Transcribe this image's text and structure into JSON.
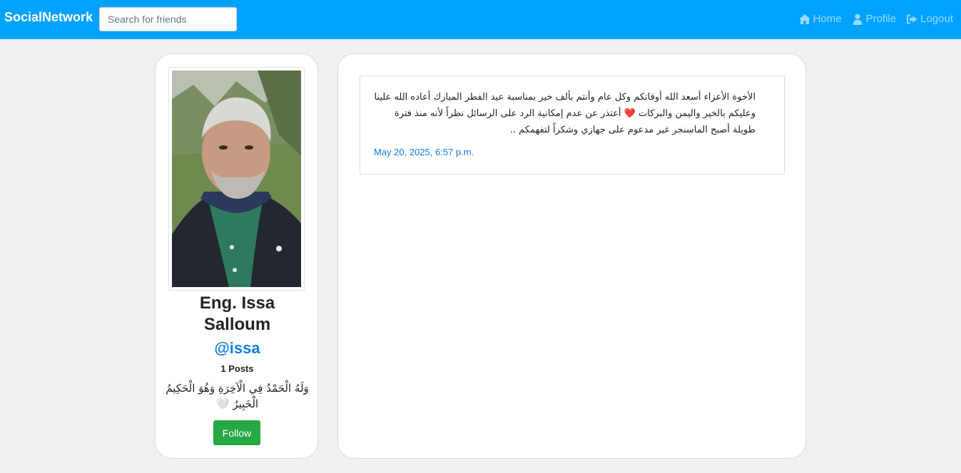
{
  "nav": {
    "brand": "SocialNetwork",
    "search_placeholder": "Search for friends",
    "links": {
      "home": "Home",
      "profile": "Profile",
      "logout": "Logout"
    }
  },
  "profile": {
    "name": "Eng. Issa Salloum",
    "handle": "@issa",
    "posts_count": "1 Posts",
    "bio": "وَلَهُ الْحَمْدُ فِي الْآخِرَةِ وَهُوَ الْحَكِيمُ الْخَبِيرُ 🤍",
    "follow_label": "Follow"
  },
  "feed": {
    "posts": [
      {
        "text": "الأخوة الأعزاء أسعد الله أوقاتكم وكل عام وأنتم بألف خير بمناسبة عيد الفطر المبارك أعاده الله علينا وعليكم بالخير واليمن والبركات ❤️ أعتذر عن عدم إمكانية الرد على الرسائل نظراً لأنه منذ فترة طويلة أصبح الماسنجر غير مدعوم على جهازي وشكراً لتفهمكم ..",
        "date": "May 20, 2025, 6:57 p.m."
      }
    ]
  },
  "colors": {
    "navbar": "#00a2ff",
    "link_blue": "#0d7ee6",
    "follow_green": "#28a745",
    "background": "#f0f0f0"
  },
  "icons": [
    "home-icon",
    "user-icon",
    "logout-icon"
  ]
}
